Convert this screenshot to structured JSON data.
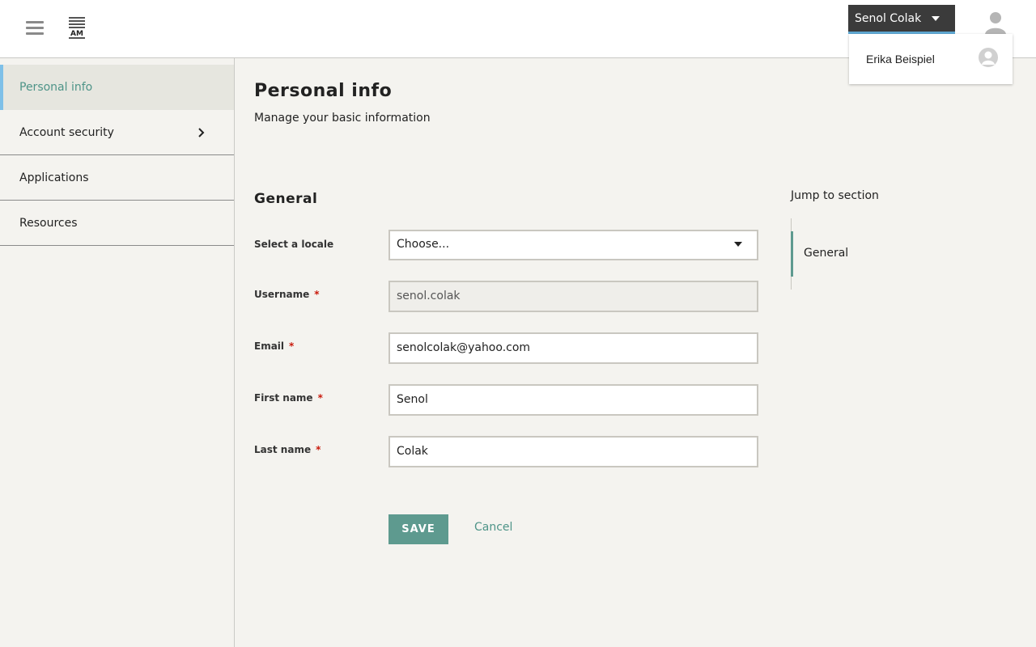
{
  "header": {
    "user_button_label": "Senol Colak",
    "dropdown_item_label": "Erika Beispiel"
  },
  "sidebar": {
    "items": [
      {
        "label": "Personal info"
      },
      {
        "label": "Account security"
      },
      {
        "label": "Applications"
      },
      {
        "label": "Resources"
      }
    ]
  },
  "main": {
    "title": "Personal info",
    "subtitle": "Manage your basic information",
    "section_title": "General",
    "fields": {
      "locale": {
        "label": "Select a locale",
        "value": "Choose..."
      },
      "username": {
        "label": "Username",
        "value": "senol.colak",
        "required": "*"
      },
      "email": {
        "label": "Email",
        "value": "senolcolak@yahoo.com",
        "required": "*"
      },
      "first_name": {
        "label": "First name",
        "value": "Senol",
        "required": "*"
      },
      "last_name": {
        "label": "Last name",
        "value": "Colak",
        "required": "*"
      }
    },
    "save_label": "SAVE",
    "cancel_label": "Cancel"
  },
  "jump": {
    "title": "Jump to section",
    "items": [
      {
        "label": "General"
      }
    ]
  },
  "colors": {
    "accent": "#5e9a8f",
    "active_bar": "#7ec0e8",
    "required": "#c9190b",
    "user_button_bg": "#3b3b3b"
  }
}
